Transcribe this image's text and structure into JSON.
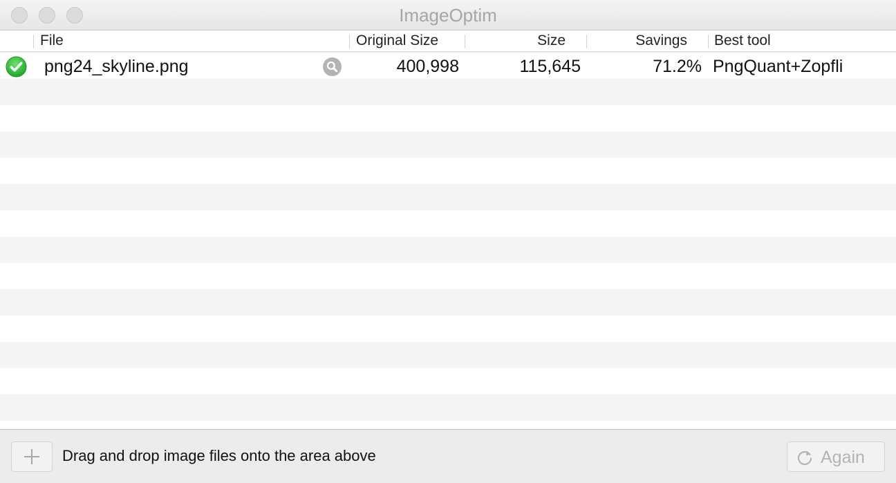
{
  "window": {
    "title": "ImageOptim"
  },
  "table": {
    "columns": {
      "file": "File",
      "original_size": "Original Size",
      "size": "Size",
      "savings": "Savings",
      "best_tool": "Best tool"
    },
    "rows": [
      {
        "status_icon": "success-check-icon",
        "file": "png24_skyline.png",
        "original_size": "400,998",
        "size": "115,645",
        "savings": "71.2%",
        "best_tool": "PngQuant+Zopfli"
      }
    ]
  },
  "bottom_bar": {
    "add_icon": "plus-icon",
    "hint": "Drag and drop image files onto the area above",
    "again_icon": "refresh-icon",
    "again_label": "Again"
  },
  "colors": {
    "success": "#2fbf3a",
    "stripe": "#f4f4f4",
    "disabled_text": "#b4b4b4"
  }
}
